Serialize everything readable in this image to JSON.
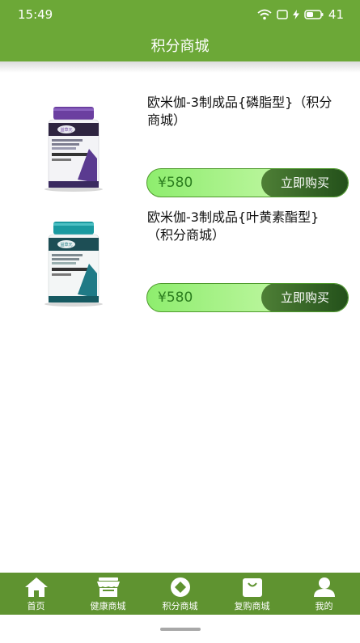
{
  "status_bar": {
    "time": "15:49",
    "battery": "41"
  },
  "header": {
    "title": "积分商城"
  },
  "products": [
    {
      "name": "欧米伽-3制成品{磷脂型}（积分商城）",
      "price": "¥580",
      "buy_label": "立即购买",
      "accent": "#6b3fa0"
    },
    {
      "name": "欧米伽-3制成品{叶黄素酯型}（积分商城）",
      "price": "¥580",
      "buy_label": "立即购买",
      "accent": "#1a9aa0"
    }
  ],
  "bottom_nav": {
    "items": [
      {
        "label": "首页",
        "icon": "home-icon"
      },
      {
        "label": "健康商城",
        "icon": "store-icon"
      },
      {
        "label": "积分商城",
        "icon": "points-icon"
      },
      {
        "label": "复购商城",
        "icon": "bag-icon"
      },
      {
        "label": "我的",
        "icon": "user-icon"
      }
    ]
  },
  "colors": {
    "primary": "#6ca837",
    "tab_bar": "#5f9330",
    "buy_button": "#2f5e22",
    "price_text": "#2b7d1e"
  }
}
